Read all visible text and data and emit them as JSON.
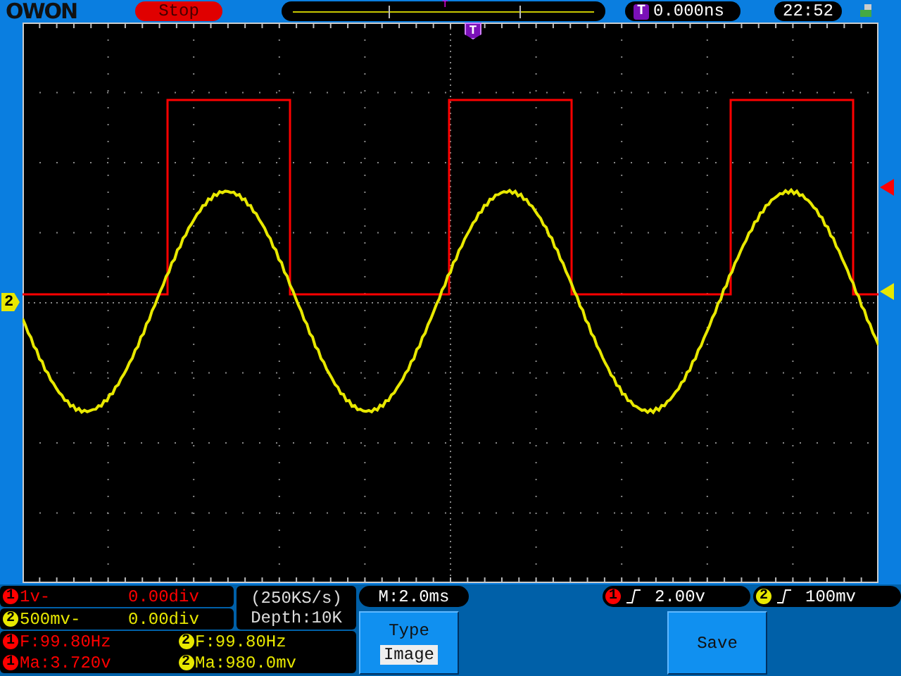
{
  "top_bar": {
    "logo": "OWON",
    "run_state": "Stop",
    "trigger_position": {
      "marker": "T"
    },
    "trigger_offset": {
      "marker": "T",
      "value": "0.000ns"
    },
    "clock": "22:52"
  },
  "screen": {
    "trigger_marker": "T",
    "channel_marker": {
      "label": "2",
      "color": "#e8e800"
    },
    "level_markers": [
      {
        "color": "#ff0000"
      },
      {
        "color": "#e8e800"
      }
    ]
  },
  "channels": [
    {
      "number": "1",
      "scale": "1v-",
      "offset": "0.00div",
      "color": "#ff0000"
    },
    {
      "number": "2",
      "scale": "500mv-",
      "offset": "0.00div",
      "color": "#e8e800"
    }
  ],
  "acquisition": {
    "sample_rate": "(250KS/s)",
    "depth": "Depth:10K"
  },
  "measurements": [
    {
      "channel": "1",
      "reading": "F:99.80Hz",
      "color": "#ff0000"
    },
    {
      "channel": "2",
      "reading": "F:99.80Hz",
      "color": "#e8e800"
    },
    {
      "channel": "1",
      "reading": "Ma:3.720v",
      "color": "#ff0000"
    },
    {
      "channel": "2",
      "reading": "Ma:980.0mv",
      "color": "#e8e800"
    }
  ],
  "timebase": "M:2.0ms",
  "triggers": [
    {
      "channel": "1",
      "level": "2.00v",
      "color": "#ff0000"
    },
    {
      "channel": "2",
      "level": "100mv",
      "color": "#e8e800"
    }
  ],
  "menu": [
    {
      "kind": "option",
      "title": "Type",
      "value": "Image"
    },
    {
      "kind": "action",
      "title": "Save"
    }
  ]
}
